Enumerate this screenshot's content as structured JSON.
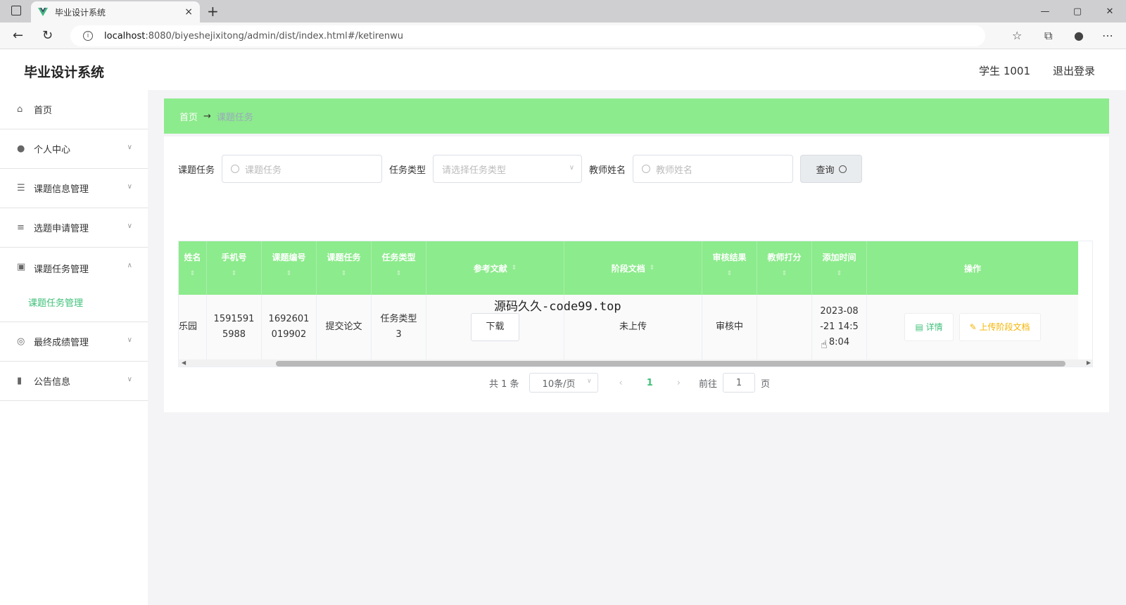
{
  "browser": {
    "tab_title": "毕业设计系统",
    "tab_close": "×",
    "new_tab": "+",
    "url_host": "localhost",
    "url_path": ":8080/biyeshejixitong/admin/dist/index.html#/ketirenwu",
    "win_min": "—",
    "win_max": "▢",
    "win_close": "✕"
  },
  "header": {
    "title": "毕业设计系统",
    "user": "学生 1001",
    "logout": "退出登录"
  },
  "sidebar": {
    "items": [
      {
        "label": "首页",
        "icon": "home-icon"
      },
      {
        "label": "个人中心",
        "icon": "user-icon"
      },
      {
        "label": "课题信息管理",
        "icon": "sliders-icon"
      },
      {
        "label": "选题申请管理",
        "icon": "list-icon"
      },
      {
        "label": "课题任务管理",
        "icon": "chart-icon"
      },
      {
        "label": "最终成绩管理",
        "icon": "target-icon"
      },
      {
        "label": "公告信息",
        "icon": "notice-icon"
      }
    ],
    "submenu_active": "课题任务管理"
  },
  "breadcrumb": {
    "home": "首页",
    "arrow": "→",
    "current": "课题任务"
  },
  "search": {
    "label1": "课题任务",
    "placeholder1": "课题任务",
    "label2": "任务类型",
    "placeholder2": "请选择任务类型",
    "label3": "教师姓名",
    "placeholder3": "教师姓名",
    "query": "查询"
  },
  "table": {
    "columns": [
      "姓名",
      "手机号",
      "课题编号",
      "课题任务",
      "任务类型",
      "参考文献",
      "阶段文档",
      "审核结果",
      "教师打分",
      "添加时间",
      "操作"
    ],
    "row": {
      "name": "乐园",
      "phone": "15915915988",
      "code": "1692601019902",
      "task": "提交论文",
      "type": "任务类型3",
      "reference": "下载",
      "stage_doc": "未上传",
      "audit": "审核中",
      "score": "",
      "time": "2023-08-21 14:58:04",
      "detail": "详情",
      "upload": "上传阶段文档"
    }
  },
  "pager": {
    "total": "共 1 条",
    "size": "10条/页",
    "prev": "‹",
    "page": "1",
    "next": "›",
    "goto": "前往",
    "goto_value": "1",
    "page_unit": "页"
  },
  "overlay": {
    "watermark": "源码久久-code99.top"
  }
}
